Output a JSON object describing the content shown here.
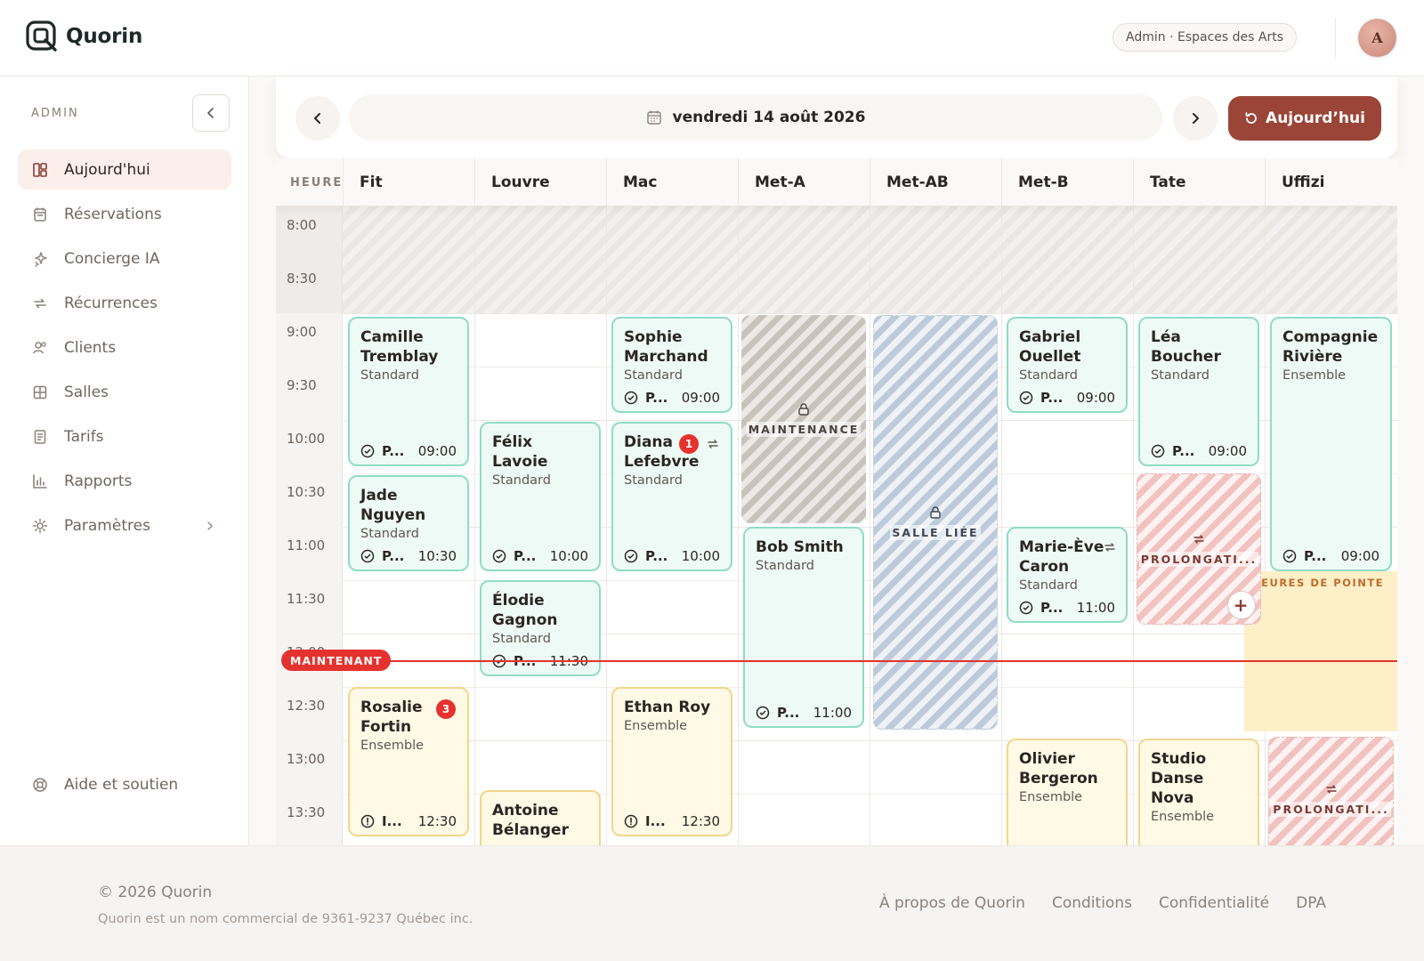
{
  "app": {
    "name": "Quorin"
  },
  "header": {
    "org_pill": "Admin · Espaces des Arts",
    "avatar_initial": "A"
  },
  "sidebar": {
    "title": "ADMIN",
    "items": [
      {
        "label": "Aujourd'hui",
        "icon": "dashboard-icon",
        "active": true
      },
      {
        "label": "Réservations",
        "icon": "calendar-icon"
      },
      {
        "label": "Concierge IA",
        "icon": "sparkles-icon"
      },
      {
        "label": "Récurrences",
        "icon": "repeat-icon"
      },
      {
        "label": "Clients",
        "icon": "users-icon"
      },
      {
        "label": "Salles",
        "icon": "grid-icon"
      },
      {
        "label": "Tarifs",
        "icon": "receipt-icon"
      },
      {
        "label": "Rapports",
        "icon": "bar-chart-icon"
      },
      {
        "label": "Paramètres",
        "icon": "gear-icon",
        "has_submenu": true
      }
    ],
    "help_label": "Aide et soutien"
  },
  "toolbar": {
    "date_label": "vendredi 14 août 2026",
    "today_label": "Aujourd’hui"
  },
  "calendar": {
    "hour_header": "HEURE",
    "rooms": [
      "Fit",
      "Louvre",
      "Mac",
      "Met-A",
      "Met-AB",
      "Met-B",
      "Tate",
      "Uffizi"
    ],
    "hours": [
      "8:00",
      "8:30",
      "9:00",
      "9:30",
      "10:00",
      "10:30",
      "11:00",
      "11:30",
      "12:00",
      "12:30",
      "13:00",
      "13:30"
    ],
    "now_label": "MAINTENANT",
    "peak_label": "HEURES DE POINTE",
    "events": [
      {
        "name": "Camille Tremblay",
        "type": "Standard",
        "status": "P...",
        "time": "09:00"
      },
      {
        "name": "Jade Nguyen",
        "type": "Standard",
        "status": "P...",
        "time": "10:30"
      },
      {
        "name": "Rosalie Fortin",
        "type": "Ensemble",
        "status": "I...",
        "time": "12:30",
        "badge": "3"
      },
      {
        "name": "Félix Lavoie",
        "type": "Standard",
        "status": "P...",
        "time": "10:00"
      },
      {
        "name": "Élodie Gagnon",
        "type": "Standard",
        "status": "P...",
        "time": "11:30"
      },
      {
        "name": "Antoine Bélanger",
        "type": "",
        "status": "",
        "time": ""
      },
      {
        "name": "Sophie Marchand",
        "type": "Standard",
        "status": "P...",
        "time": "09:00"
      },
      {
        "name": "Diana Lefebvre",
        "type": "Standard",
        "status": "P...",
        "time": "10:00",
        "badge": "1"
      },
      {
        "name": "Ethan Roy",
        "type": "Ensemble",
        "status": "I...",
        "time": "12:30"
      },
      {
        "name": "Bob Smith",
        "type": "Standard",
        "status": "P...",
        "time": "11:00"
      },
      {
        "name": "Gabriel Ouellet",
        "type": "Standard",
        "status": "P...",
        "time": "09:00"
      },
      {
        "name": "Marie-Ève Caron",
        "type": "Standard",
        "status": "P...",
        "time": "11:00"
      },
      {
        "name": "Olivier Bergeron",
        "type": "Ensemble",
        "status": "",
        "time": ""
      },
      {
        "name": "Léa Boucher",
        "type": "Standard",
        "status": "P...",
        "time": "09:00"
      },
      {
        "name": "Studio Danse Nova",
        "type": "Ensemble",
        "status": "",
        "time": ""
      },
      {
        "name": "Compagnie Rivière",
        "type": "Ensemble",
        "status": "P...",
        "time": "09:00"
      }
    ],
    "blocks": {
      "maintenance": "MAINTENANCE",
      "linked": "SALLE LIÉE",
      "prolong": "PROLONGATI..."
    }
  },
  "footer": {
    "copyright": "© 2026 Quorin",
    "legal": "Quorin est un nom commercial de 9361-9237 Québec inc.",
    "links": [
      "À propos de Quorin",
      "Conditions",
      "Confidentialité",
      "DPA"
    ]
  },
  "colors": {
    "accent": "#9b4538",
    "confirmed_border": "#8fdcc4",
    "pending_border": "#f3d58b",
    "now": "#e5322e",
    "peak_bg": "#fdf0c8"
  }
}
